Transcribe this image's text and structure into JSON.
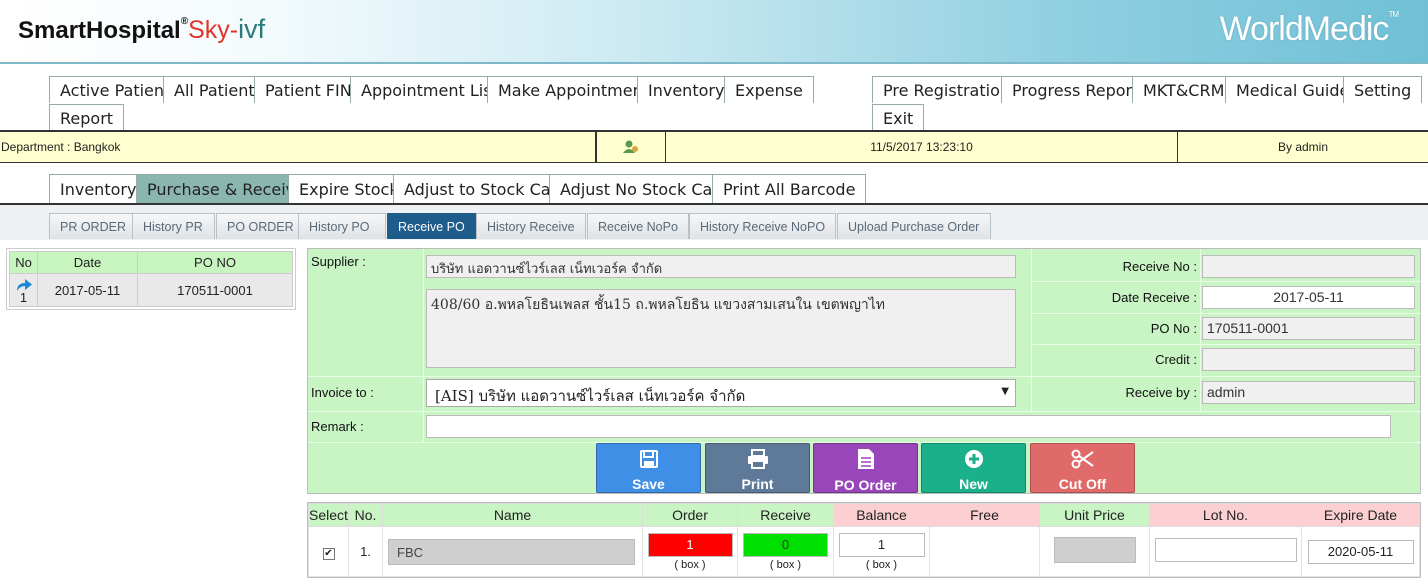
{
  "header": {
    "logo_main": "SmartHospital",
    "logo_reg": "®",
    "logo_sky": "Sky-",
    "logo_ivf": "ivf",
    "brand": "WorldMedic",
    "brand_tm": "TM"
  },
  "main_nav": {
    "left": [
      "Active Patient",
      "All Patient",
      "Patient FIN",
      "Appointment List",
      "Make Appointment",
      "Inventory",
      "Expense",
      "Report"
    ],
    "right": [
      "Pre Registration",
      "Progress Report",
      "MKT&CRM",
      "Medical Guide",
      "Setting",
      "Exit"
    ]
  },
  "info_bar": {
    "department": "Department : Bangkok",
    "datetime": "11/5/2017 13:23:10",
    "by": "By admin"
  },
  "sub_nav": [
    "Inventory",
    "Purchase & Receive",
    "Expire Stock",
    "Adjust to Stock Card",
    "Adjust No Stock Card",
    "Print All Barcode"
  ],
  "sub_nav_active": "Purchase & Receive",
  "third_nav": [
    "PR ORDER",
    "History PR",
    "PO ORDER",
    "History PO",
    "Receive PO",
    "History Receive",
    "Receive NoPo",
    "History Receive NoPO",
    "Upload Purchase Order"
  ],
  "third_nav_active": "Receive PO",
  "po_list": {
    "headers": [
      "No",
      "Date",
      "PO NO"
    ],
    "rows": [
      {
        "no": "1",
        "date": "2017-05-11",
        "po_no": "170511-0001"
      }
    ]
  },
  "form": {
    "supplier_label": "Supplier :",
    "supplier_name": "บริษัท แอดวานซ์ไวร์เลส เน็ทเวอร์ค จำกัด",
    "supplier_address": "408/60 อ.พหลโยธินเพลส ชั้น15 ถ.พหลโยธิน แขวงสามเสนใน เขตพญาไท",
    "invoice_label": "Invoice to :",
    "invoice_value": "[AIS] บริษัท แอดวานซ์ไวร์เลส เน็ทเวอร์ค จำกัด",
    "remark_label": "Remark :",
    "remark_value": "",
    "receive_no_label": "Receive No :",
    "receive_no": "",
    "date_receive_label": "Date Receive :",
    "date_receive": "2017-05-11",
    "po_no_label": "PO No :",
    "po_no": "170511-0001",
    "credit_label": "Credit :",
    "credit": "",
    "receive_by_label": "Receive by :",
    "receive_by": "admin"
  },
  "buttons": {
    "save": "Save",
    "print": "Print",
    "po_order": "PO Order",
    "new": "New",
    "cut_off": "Cut Off"
  },
  "colors": {
    "save": "#3f8fe6",
    "print": "#5f7a98",
    "po_order": "#9a46bb",
    "new": "#19b08a",
    "cut_off": "#e06a6a",
    "form_bg": "#c9f4c4"
  },
  "items": {
    "headers": [
      "Select",
      "No.",
      "Name",
      "Order",
      "Receive",
      "Balance",
      "Free",
      "Unit Price",
      "Lot No.",
      "Expire Date"
    ],
    "rows": [
      {
        "no": "1.",
        "name": "FBC",
        "order": "1",
        "order_unit": "( box )",
        "receive": "0",
        "receive_unit": "( box )",
        "balance": "1",
        "balance_unit": "( box )",
        "free": "",
        "unit_price": "",
        "lot_no": "",
        "expire_date": "2020-05-11"
      }
    ]
  }
}
